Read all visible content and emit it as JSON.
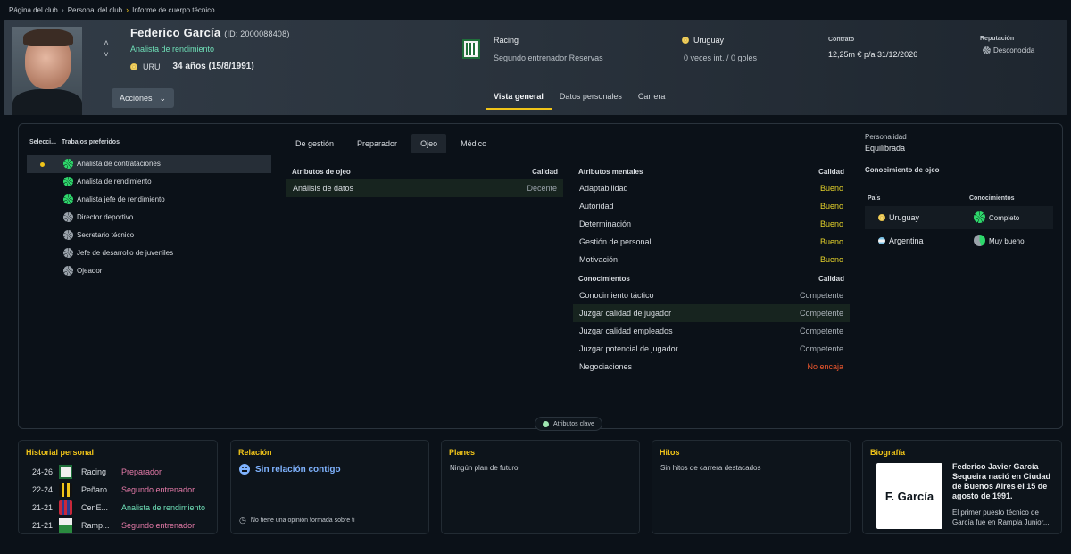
{
  "breadcrumb": [
    "Página del club",
    "Personal del club",
    "Informe de cuerpo técnico"
  ],
  "person": {
    "name": "Federico García",
    "id": "(ID: 2000088408)",
    "role": "Analista de rendimiento",
    "nationality": "URU",
    "age": "34 años (15/8/1991)"
  },
  "actions_label": "Acciones",
  "club": {
    "name": "Racing",
    "role": "Segundo entrenador Reservas"
  },
  "international": {
    "country": "Uruguay",
    "stats": "0 veces int. / 0 goles"
  },
  "contract": {
    "label": "Contrato",
    "value": "12,25m € p/a  31/12/2026"
  },
  "reputation": {
    "label": "Reputación",
    "value": "Desconocida"
  },
  "header_tabs": [
    {
      "label": "Vista general",
      "active": true
    },
    {
      "label": "Datos personales",
      "active": false
    },
    {
      "label": "Carrera",
      "active": false
    }
  ],
  "jobs": {
    "col_selected": "Selecci...",
    "col_jobs": "Trabajos preferidos",
    "items": [
      {
        "label": "Analista de contrataciones",
        "icon": "green-star-icon",
        "selected": true
      },
      {
        "label": "Analista de rendimiento",
        "icon": "green-star-icon",
        "selected": false
      },
      {
        "label": "Analista jefe de rendimiento",
        "icon": "green-star-icon",
        "selected": false
      },
      {
        "label": "Director deportivo",
        "icon": "grey-star-icon",
        "selected": false
      },
      {
        "label": "Secretario técnico",
        "icon": "grey-star-icon",
        "selected": false
      },
      {
        "label": "Jefe de desarrollo de juveniles",
        "icon": "grey-star-icon",
        "selected": false
      },
      {
        "label": "Ojeador",
        "icon": "grey-star-icon",
        "selected": false
      }
    ]
  },
  "attr_tabs": [
    {
      "label": "De gestión",
      "active": false
    },
    {
      "label": "Preparador",
      "active": false
    },
    {
      "label": "Ojeo",
      "active": true
    },
    {
      "label": "Médico",
      "active": false
    }
  ],
  "scout_attrs": {
    "header": "Atributos de ojeo",
    "quality_header": "Calidad",
    "rows": [
      {
        "name": "Análisis de datos",
        "quality": "Decente"
      }
    ]
  },
  "mental_attrs": {
    "header": "Atributos mentales",
    "quality_header": "Calidad",
    "rows": [
      {
        "name": "Adaptabilidad",
        "quality": "Bueno"
      },
      {
        "name": "Autoridad",
        "quality": "Bueno"
      },
      {
        "name": "Determinación",
        "quality": "Bueno"
      },
      {
        "name": "Gestión de personal",
        "quality": "Bueno"
      },
      {
        "name": "Motivación",
        "quality": "Bueno"
      }
    ]
  },
  "knowledge_attrs": {
    "header": "Conocimientos",
    "quality_header": "Calidad",
    "rows": [
      {
        "name": "Conocimiento táctico",
        "quality": "Competente"
      },
      {
        "name": "Juzgar calidad de jugador",
        "quality": "Competente"
      },
      {
        "name": "Juzgar calidad empleados",
        "quality": "Competente"
      },
      {
        "name": "Juzgar potencial de jugador",
        "quality": "Competente"
      },
      {
        "name": "Negociaciones",
        "quality": "No encaja"
      }
    ]
  },
  "personality": {
    "label": "Personalidad",
    "value": "Equilibrada"
  },
  "scout_knowledge": {
    "title": "Conocimiento de ojeo",
    "col_country": "País",
    "col_knowledge": "Conocimientos",
    "rows": [
      {
        "country": "Uruguay",
        "level": "Completo"
      },
      {
        "country": "Argentina",
        "level": "Muy bueno"
      }
    ]
  },
  "key_attrs_label": "Atributos clave",
  "history": {
    "title": "Historial personal",
    "rows": [
      {
        "years": "24-26",
        "club": "Racing",
        "role": "Preparador"
      },
      {
        "years": "22-24",
        "club": "Peñaro",
        "role": "Segundo entrenador"
      },
      {
        "years": "21-21",
        "club": "CenE...",
        "role": "Analista de rendimiento"
      },
      {
        "years": "21-21",
        "club": "Ramp...",
        "role": "Segundo entrenador"
      }
    ]
  },
  "relation": {
    "title": "Relación",
    "main": "Sin relación contigo",
    "note": "No tiene una opinión formada sobre ti"
  },
  "plans": {
    "title": "Planes",
    "text": "Ningún plan de futuro"
  },
  "milestones": {
    "title": "Hitos",
    "text": "Sin hitos de carrera destacados"
  },
  "bio": {
    "title": "Biografía",
    "logo": "F. García",
    "headline": "Federico Javier García Sequeira nació en Ciudad de Buenos Aires el 15 de agosto de 1991.",
    "body": "El primer puesto técnico de García fue en Rampla Junior..."
  },
  "colors": {
    "accent": "#f0c419",
    "teal": "#6fe0b8",
    "good": "#e5d22a",
    "bad": "#f1582e"
  }
}
